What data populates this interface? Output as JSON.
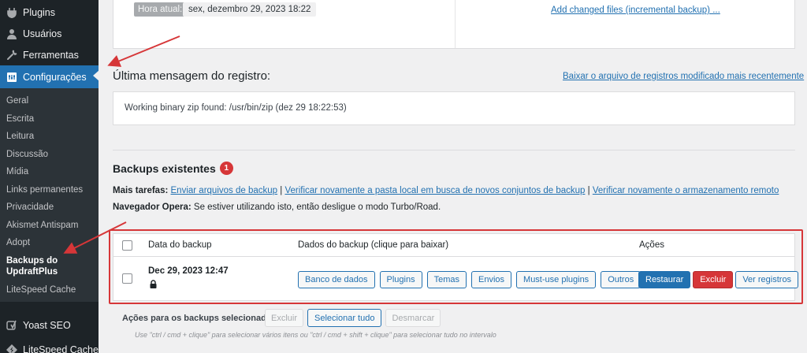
{
  "sidebar": {
    "items_top": [
      {
        "label": "Plugins",
        "icon": "plugin-icon"
      },
      {
        "label": "Usuários",
        "icon": "user-icon"
      },
      {
        "label": "Ferramentas",
        "icon": "wrench-icon"
      }
    ],
    "active": {
      "label": "Configurações",
      "icon": "settings-icon"
    },
    "submenu": [
      "Geral",
      "Escrita",
      "Leitura",
      "Discussão",
      "Mídia",
      "Links permanentes",
      "Privacidade",
      "Akismet Antispam",
      "Adopt",
      "Backups do UpdraftPlus",
      "LiteSpeed Cache"
    ],
    "current_sub_index": 9,
    "items_bottom": [
      {
        "label": "Yoast SEO",
        "icon": "yoast-icon"
      },
      {
        "label": "LiteSpeed Cache",
        "icon": "litespeed-icon"
      }
    ]
  },
  "top": {
    "time_label": "Hora atual:",
    "time_value": "sex, dezembro 29, 2023 18:22",
    "incremental_link": "Add changed files (incremental backup) ..."
  },
  "log": {
    "title": "Última mensagem do registro:",
    "download_link": "Baixar o arquivo de registros modificado mais recentemente",
    "message": "Working binary zip found: /usr/bin/zip (dez 29 18:22:53)"
  },
  "backups": {
    "title": "Backups existentes",
    "count": "1",
    "more_tasks_label": "Mais tarefas:",
    "task_links": [
      "Enviar arquivos de backup",
      "Verificar novamente a pasta local em busca de novos conjuntos de backup",
      "Verificar novamente o armazenamento remoto"
    ],
    "separator": " | ",
    "opera_label": "Navegador Opera:",
    "opera_text": " Se estiver utilizando isto, então desligue o modo Turbo/Road."
  },
  "table": {
    "col_date": "Data do backup",
    "col_data": "Dados do backup (clique para baixar)",
    "col_actions": "Ações",
    "row": {
      "date": "Dec 29, 2023 12:47",
      "data_buttons": [
        "Banco de dados",
        "Plugins",
        "Temas",
        "Envios",
        "Must-use plugins",
        "Outros"
      ],
      "restore": "Restaurar",
      "delete": "Excluir",
      "view_log": "Ver registros"
    }
  },
  "bulk": {
    "label": "Ações para os backups selecionados",
    "delete": "Excluir",
    "select_all": "Selecionar tudo",
    "deselect": "Desmarcar",
    "hint": "Use \"ctrl / cmd + clique\" para selecionar vários itens ou \"ctrl / cmd + shift + clique\" para selecionar tudo no intervalo"
  },
  "colors": {
    "sidebar_bg": "#1d2327",
    "accent": "#2271b1",
    "danger": "#d63638",
    "annotation": "#d63638"
  }
}
